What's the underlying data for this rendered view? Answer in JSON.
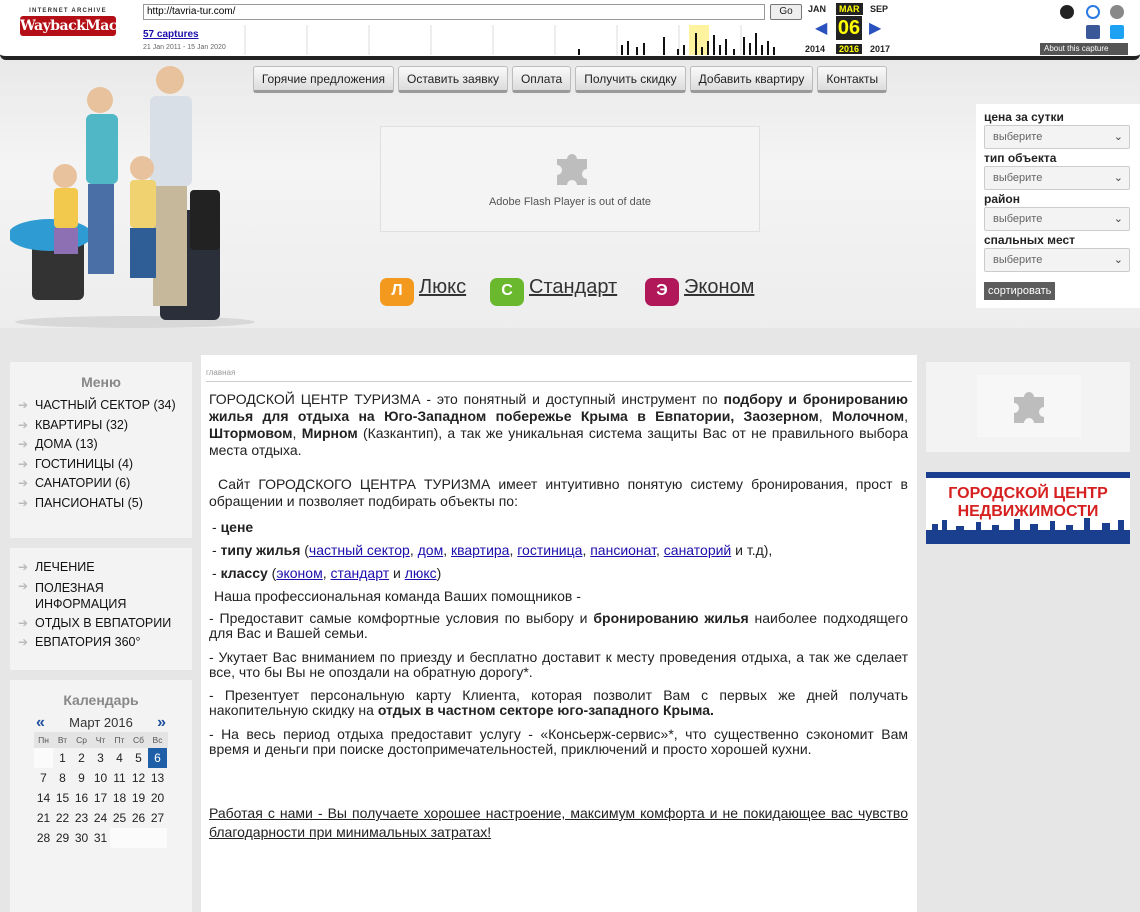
{
  "wayback": {
    "logo_top": "INTERNET ARCHIVE",
    "logo_main": "WaybackMachine",
    "url": "http://tavria-tur.com/",
    "go_label": "Go",
    "captures": "57 captures",
    "range": "21 Jan 2011 - 15 Jan 2020",
    "month_prev": "JAN",
    "month_cur": "MAR",
    "month_next": "SEP",
    "day": "06",
    "year_prev": "2014",
    "year_cur": "2016",
    "year_next": "2017",
    "about": "About this capture",
    "sparkline": [
      0,
      0,
      0,
      0,
      0,
      0,
      0,
      0,
      0,
      0,
      0,
      0,
      0,
      0,
      0,
      0,
      0,
      0,
      0,
      0,
      0,
      0,
      0,
      0,
      0,
      0,
      0,
      0,
      0,
      0,
      0,
      0,
      0,
      0,
      0,
      0,
      0,
      0,
      0,
      0,
      0,
      0,
      0,
      0,
      0,
      0,
      0,
      0,
      0,
      0,
      0,
      0,
      0,
      0,
      0,
      0,
      0,
      0,
      0,
      0,
      0,
      0,
      0,
      0,
      0,
      0,
      0,
      0,
      0,
      0,
      0,
      0,
      0,
      0,
      0,
      0,
      0,
      0,
      0,
      0,
      0,
      0,
      0,
      0,
      0,
      0,
      0,
      0,
      0,
      0,
      0,
      0,
      0,
      0,
      0,
      0,
      0,
      0,
      0,
      0,
      0,
      0,
      0,
      0,
      0,
      0,
      0,
      0,
      0,
      0,
      0,
      0,
      0,
      0,
      0,
      0,
      0,
      0,
      0,
      0,
      0,
      0,
      0,
      0,
      0,
      0,
      0,
      0,
      0,
      0,
      0,
      0,
      0,
      0,
      0,
      0,
      0,
      0,
      0,
      0,
      0,
      0,
      0,
      0,
      0,
      0,
      0,
      0,
      0,
      0,
      0,
      0,
      0,
      0,
      0,
      0,
      0,
      0,
      0,
      0,
      0,
      0,
      0,
      0,
      0,
      0,
      0,
      0,
      0,
      0,
      0,
      0,
      0,
      0,
      0,
      0,
      0,
      0,
      0,
      0,
      0,
      0,
      0,
      0,
      0,
      0,
      0,
      0,
      0,
      0,
      0,
      0,
      0,
      0,
      0,
      0,
      0,
      0,
      0,
      0,
      0,
      0,
      0,
      0,
      0,
      0,
      0,
      0,
      0,
      0,
      0,
      0,
      0,
      0,
      0,
      0,
      0,
      0,
      0,
      0,
      0,
      0,
      0,
      0,
      0,
      0,
      0,
      0,
      0,
      0,
      0,
      0,
      0,
      0,
      0,
      0,
      0,
      0,
      0,
      0,
      0,
      0,
      0,
      0,
      0,
      0,
      0,
      0,
      0,
      0,
      0,
      0,
      0,
      0,
      0,
      0,
      0,
      0,
      0,
      0,
      0,
      0,
      0,
      0,
      0,
      0,
      0,
      0,
      0,
      0,
      0,
      0,
      0,
      0,
      0,
      0,
      0,
      0,
      0,
      0,
      0,
      0,
      0,
      0,
      0,
      0,
      0,
      0,
      0,
      0,
      0,
      0,
      0,
      0,
      0,
      0,
      0,
      0,
      0,
      0,
      0,
      0,
      0,
      0,
      0,
      0,
      0,
      0,
      0,
      0,
      0,
      0,
      0,
      0,
      0,
      0,
      0,
      0,
      0,
      0,
      0,
      0,
      0,
      0,
      0,
      0,
      0,
      0,
      0,
      0,
      0,
      0,
      0,
      0,
      0,
      0,
      0,
      0,
      0,
      0,
      0,
      0,
      0,
      0,
      0,
      0,
      0,
      0,
      0,
      0,
      0,
      0,
      0,
      0,
      0,
      0,
      0,
      0,
      0,
      0,
      0,
      0,
      0,
      0,
      0,
      0,
      0,
      0,
      0,
      0,
      0,
      0,
      0,
      0,
      0,
      0,
      0,
      0,
      0,
      0,
      0,
      0,
      0,
      0,
      0,
      0,
      0,
      0,
      0,
      0,
      0,
      0,
      0,
      0,
      0,
      0,
      0,
      0,
      0,
      0,
      0,
      0,
      0,
      0,
      0,
      0,
      0,
      0,
      0,
      0,
      0,
      0,
      0,
      0,
      0,
      0,
      0,
      0,
      0,
      0,
      0,
      0,
      0,
      0,
      0,
      0,
      0,
      0,
      0,
      0,
      0,
      0,
      0,
      0,
      0,
      0,
      0,
      0,
      0,
      0,
      0,
      0,
      0,
      0,
      0,
      0,
      0,
      0,
      0,
      0,
      0,
      0,
      0,
      0,
      0,
      0,
      0,
      0,
      0,
      0,
      0,
      0,
      0,
      0,
      0,
      0,
      0,
      0,
      0,
      0,
      0,
      0,
      0,
      0,
      0,
      0,
      0,
      0,
      0,
      0,
      0,
      0,
      0,
      0,
      0,
      0,
      0,
      0,
      0,
      0,
      0,
      0,
      0,
      0,
      0,
      0,
      0,
      0,
      0,
      0,
      0,
      0,
      0,
      0,
      0,
      0,
      0,
      0,
      0,
      0,
      0,
      0,
      0,
      0,
      0,
      0,
      0,
      0,
      0,
      0,
      0,
      0,
      0,
      0,
      0,
      0,
      0,
      0,
      0,
      0,
      0,
      0,
      0,
      0,
      0,
      0,
      0,
      0,
      0,
      0,
      0,
      0,
      0,
      0,
      0,
      0,
      0,
      0,
      0,
      0,
      0,
      0,
      0,
      0,
      0,
      0,
      0,
      0,
      0,
      0,
      0,
      0,
      0,
      0,
      0,
      0,
      0,
      0,
      0,
      0,
      0,
      0,
      0,
      0,
      0,
      0,
      0,
      0,
      0,
      0,
      0,
      0,
      0,
      0,
      0,
      0,
      0,
      0,
      0,
      0,
      0,
      0,
      0,
      0,
      0,
      0,
      0,
      0,
      0,
      0,
      0,
      0,
      0
    ]
  },
  "nav": [
    "Горячие предложения",
    "Оставить заявку",
    "Оплата",
    "Получить скидку",
    "Добавить квартиру",
    "Контакты"
  ],
  "flash_msg": "Adobe Flash Player is out of date",
  "classes": [
    {
      "badge": "Л",
      "label": "Люкс",
      "color": "#f39a1e"
    },
    {
      "badge": "С",
      "label": "Стандарт",
      "color": "#6ab82e"
    },
    {
      "badge": "Э",
      "label": "Эконом",
      "color": "#b0185a"
    }
  ],
  "filter": {
    "labels": [
      "цена за сутки",
      "тип объекта",
      "район",
      "спальных мест"
    ],
    "placeholder": "выберите",
    "sort": "сортировать"
  },
  "menu": {
    "title": "Меню",
    "items": [
      "ЧАСТНЫЙ СЕКТОР (34)",
      "КВАРТИРЫ (32)",
      "ДОМА (13)",
      "ГОСТИНИЦЫ (4)",
      "САНАТОРИИ (6)",
      "ПАНСИОНАТЫ (5)"
    ],
    "items2": [
      "ЛЕЧЕНИЕ",
      "ПОЛЕЗНАЯ ИНФОРМАЦИЯ",
      "ОТДЫХ В ЕВПАТОРИИ",
      "ЕВПАТОРИЯ 360°"
    ]
  },
  "calendar": {
    "title": "Календарь",
    "prev": "«",
    "next": "»",
    "month": "Март 2016",
    "dow": [
      "Пн",
      "Вт",
      "Ср",
      "Чт",
      "Пт",
      "Сб",
      "Вс"
    ],
    "weeks": [
      [
        "",
        "1",
        "2",
        "3",
        "4",
        "5",
        "6"
      ],
      [
        "7",
        "8",
        "9",
        "10",
        "11",
        "12",
        "13"
      ],
      [
        "14",
        "15",
        "16",
        "17",
        "18",
        "19",
        "20"
      ],
      [
        "21",
        "22",
        "23",
        "24",
        "25",
        "26",
        "27"
      ],
      [
        "28",
        "29",
        "30",
        "31",
        "",
        "",
        ""
      ]
    ],
    "today": "6"
  },
  "content": {
    "crumb": "главная",
    "p1a": "ГОРОДСКОЙ ЦЕНТР ТУРИЗМА - это понятный и доступный инструмент по ",
    "p1b": "подбору и бронированию жилья для отдыха на Юго-Западном побережье Крыма в Евпатории, Заозерном",
    "p1c": ", ",
    "p1d": "Молочном",
    "p1e": ", ",
    "p1f": "Штормовом",
    "p1g": ", ",
    "p1h": "Мирном",
    "p1i": " (Казкантип), а так же уникальная система защиты Вас от не правильного выбора места отдыха.",
    "p2": "Сайт ГОРОДСКОГО ЦЕНТРА ТУРИЗМА имеет интуитивно понятую систему бронирования, прост в обращении и позволяет подбирать объекты по:",
    "b1": "цене",
    "b2_label": "типу жилья",
    "b2_links": [
      "частный сектор",
      "дом",
      "квартира",
      "гостиница",
      "пансионат",
      "санаторий"
    ],
    "b2_tail": " и т.д),",
    "b3_label": "классу",
    "b3_links": [
      "эконом",
      "стандарт",
      "люкс"
    ],
    "b3_and": " и ",
    "p3": "Наша профессиональная команда Ваших помощников -",
    "p4a": "- Предоставит самые комфортные условия по выбору и ",
    "p4b": "бронированию жилья",
    "p4c": " наиболее подходящего для Вас и Вашей семьи.",
    "p5": "- Укутает Вас вниманием по приезду и бесплатно доставит к месту проведения отдыха, а так же сделает все, что бы Вы не опоздали на обратную дорогу*.",
    "p6a": "- Презентует персональную карту Клиента, которая позволит Вам с первых же дней получать накопительную скидку на ",
    "p6b": "отдых в частном секторе юго-западного Крыма.",
    "p7": "- На весь период отдыха предоставит услугу - «Консьерж-сервис»*, что существенно сэкономит Вам время и деньги при поиске достопримечательностей, приключений и просто хорошей кухни.",
    "p8": "Работая с нами - Вы получаете хорошее настроение, максимум комфорта и не покидающее вас чувство благодарности при минимальных затратах!"
  },
  "banner": {
    "line1": "ГОРОДСКОЙ ЦЕНТР",
    "line2": "НЕДВИЖИМОСТИ"
  }
}
